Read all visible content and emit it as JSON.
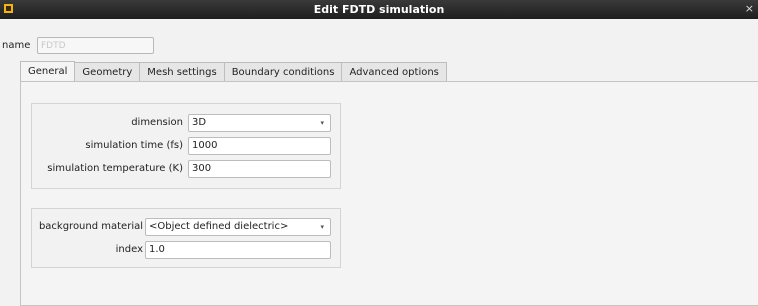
{
  "window": {
    "title": "Edit FDTD simulation",
    "close_glyph": "×",
    "icon": "app-icon"
  },
  "name_field": {
    "label": "name",
    "value": "FDTD"
  },
  "tabs": [
    {
      "label": "General",
      "active": true
    },
    {
      "label": "Geometry",
      "active": false
    },
    {
      "label": "Mesh settings",
      "active": false
    },
    {
      "label": "Boundary conditions",
      "active": false
    },
    {
      "label": "Advanced options",
      "active": false
    }
  ],
  "general": {
    "dimension": {
      "label": "dimension",
      "value": "3D",
      "arrow": "▾"
    },
    "simulation_time": {
      "label": "simulation time (fs)",
      "value": "1000"
    },
    "simulation_temperature": {
      "label": "simulation temperature (K)",
      "value": "300"
    },
    "background_material": {
      "label": "background material",
      "value": "<Object defined dielectric>",
      "arrow": "▾"
    },
    "index": {
      "label": "index",
      "value": "1.0"
    }
  }
}
